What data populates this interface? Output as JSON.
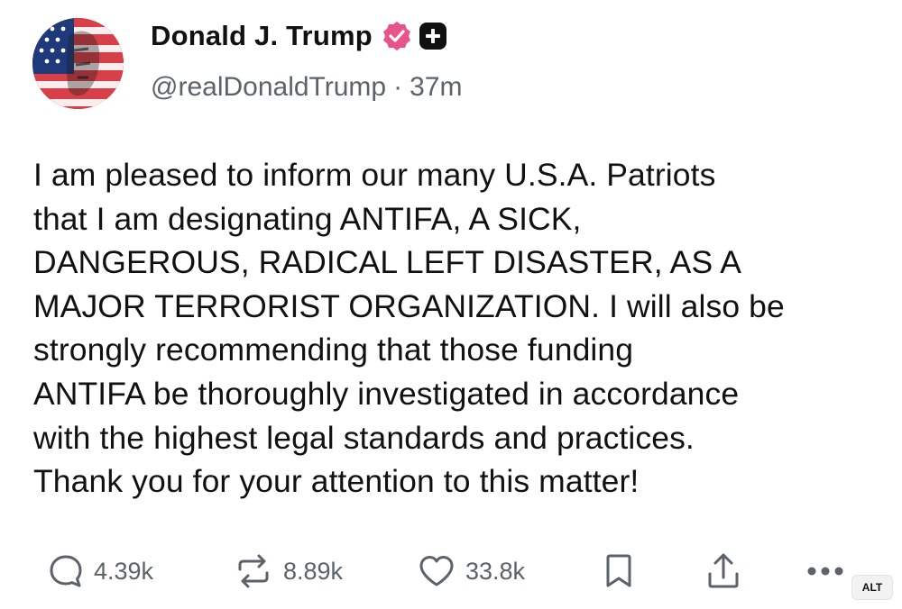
{
  "post": {
    "author": {
      "display_name": "Donald J. Trump",
      "handle": "@realDonaldTrump",
      "separator": "·",
      "time_ago": "37m"
    },
    "text": "I am pleased to inform our many U.S.A. Patriots\nthat I am designating ANTIFA, A SICK,\nDANGEROUS, RADICAL LEFT DISASTER, AS A\nMAJOR TERRORIST ORGANIZATION. I will also be\nstrongly recommending that those funding\nANTIFA be thoroughly investigated in accordance\nwith the highest legal standards and practices.\nThank you for your attention to this matter!",
    "actions": {
      "replies": "4.39k",
      "reposts": "8.89k",
      "likes": "33.8k"
    },
    "alt_label": "ALT"
  },
  "icons": {
    "avatar": "avatar-image",
    "verified": "verified-badge-icon",
    "plus": "plus-badge-icon",
    "reply": "speech-bubble-icon",
    "repost": "repost-arrows-icon",
    "like": "heart-icon",
    "bookmark": "bookmark-icon",
    "share": "share-upload-icon",
    "more": "more-dots-icon"
  },
  "colors": {
    "text": "#111111",
    "muted": "#5b6269",
    "verified": "#e8548a",
    "background": "#ffffff"
  }
}
